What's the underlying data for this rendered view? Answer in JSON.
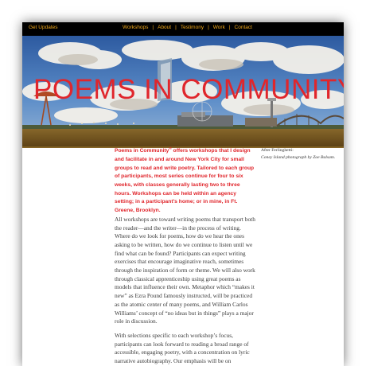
{
  "nav": {
    "get_updates": "Get Updates",
    "items": [
      "Workshops",
      "About",
      "Testimony",
      "Work",
      "Contact"
    ],
    "separator": "|"
  },
  "header": {
    "title": "POEMS IN COMMUNITY"
  },
  "caption": {
    "line1": "After Ferlinghetti:",
    "credit": "Coney Island photograph by Zoe Balsam."
  },
  "intro": {
    "brand": "Poems in Community",
    "mark": "®",
    "text": " offers workshops that I design and facilitate in and around New York City for small groups to read and write poetry. Tailored to each group of participants, most series continue for four to six weeks, with classes generally lasting two to three hours. Workshops can be held within an agency setting; in a participant’s home; or in mine, in Ft. Greene, Brooklyn."
  },
  "body": {
    "p1": "All workshops are toward writing poems that transport both the reader—and the writer—in the process of writing. Where do we look for poems, how do we hear the ones asking to be written, how do we continue to listen until we find what can be found? Participants can expect writing exercises that encourage imaginative reach, sometimes through the inspiration of form or theme. We will also work through classical apprenticeship using great poems as models that influence their own. Metaphor which “makes it new” as Ezra Pound famously instructed, will be practiced as the atomic center of many poems, and William Carlos Williams’ concept of “no ideas but in things” plays a major role in discussion.",
    "p2": "With selections specific to each workshop’s focus, participants can look forward to reading a broad range of accessible, engaging poetry, with a concentration on lyric narrative autobiography. Our emphasis will be on"
  },
  "colors": {
    "accent": "#e0262c",
    "nav_text": "#f0a81c",
    "nav_bg": "#000000"
  }
}
